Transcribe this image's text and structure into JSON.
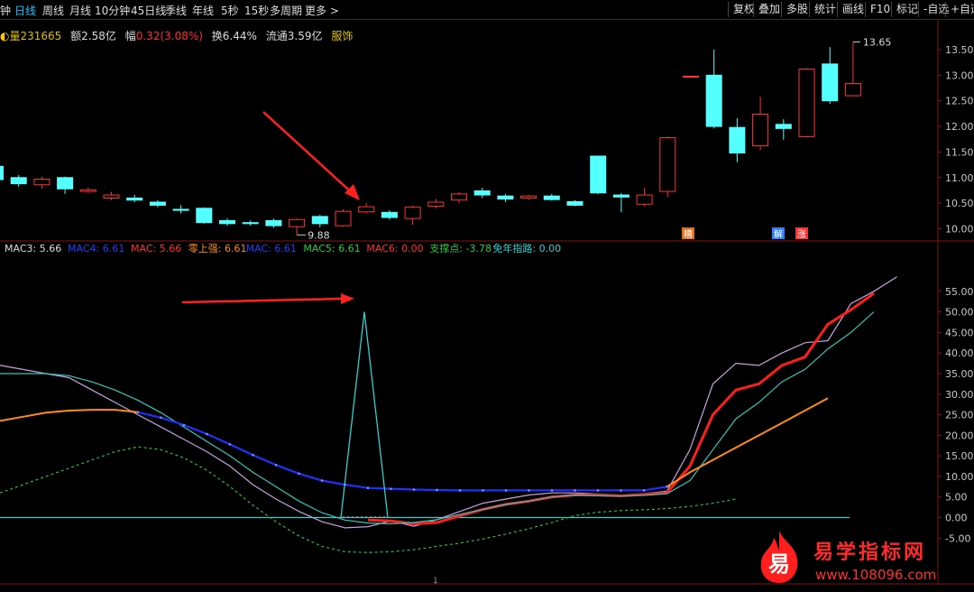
{
  "timeframes": [
    {
      "label": "钟",
      "x": 0
    },
    {
      "label": "日线",
      "x": 16,
      "active": true
    },
    {
      "label": "周线",
      "x": 47
    },
    {
      "label": "月线",
      "x": 77
    },
    {
      "label": "10分钟",
      "x": 105
    },
    {
      "label": "45日线",
      "x": 145
    },
    {
      "label": "季线",
      "x": 183
    },
    {
      "label": "年线",
      "x": 213
    },
    {
      "label": "5秒",
      "x": 245
    },
    {
      "label": "15秒",
      "x": 271
    },
    {
      "label": "多周期",
      "x": 299
    },
    {
      "label": "更多 >",
      "x": 338
    }
  ],
  "tools": [
    {
      "label": "复权",
      "x": 807
    },
    {
      "label": "叠加",
      "x": 835
    },
    {
      "label": "多股",
      "x": 866
    },
    {
      "label": "统计",
      "x": 897
    },
    {
      "label": "画线",
      "x": 928
    },
    {
      "label": "F10",
      "x": 959
    },
    {
      "label": "标记",
      "x": 988
    },
    {
      "label": "-自选",
      "x": 1018
    },
    {
      "label": "+自选",
      "x": 1048
    }
  ],
  "info": {
    "vol_label": "量",
    "vol": "231665",
    "amt_label": "额",
    "amt": "2.58亿",
    "chg_label": "幅",
    "chg": "0.32(3.08%)",
    "turn_label": "换",
    "turn": "6.44%",
    "float_label": "流通",
    "float": "3.59亿",
    "industry": "服饰"
  },
  "indicator_legend": [
    {
      "text": "MAC3: 5.66",
      "color": "#dddddd"
    },
    {
      "text": "MAC4: 6.61",
      "color": "#2040ff"
    },
    {
      "text": "MAC: 5.66",
      "color": "#ff3030"
    },
    {
      "text": "零上强: 6.61",
      "color": "#ff8c1a"
    },
    {
      "text": "MAC: 6.61",
      "color": "#2040ff"
    },
    {
      "text": "MAC5: 6.61",
      "color": "#20d040"
    },
    {
      "text": "MAC6: 0.00",
      "color": "#ff3030"
    },
    {
      "text": "支撑点: -3.78",
      "color": "#20d040"
    },
    {
      "text": "免年指路: 0.00",
      "color": "#30d0d0"
    }
  ],
  "price_axis": {
    "ticks": [
      "13.50",
      "13.00",
      "12.50",
      "12.00",
      "11.50",
      "11.00",
      "10.50",
      "10.00"
    ]
  },
  "indicator_axis": {
    "ticks": [
      "55.00",
      "50.00",
      "45.00",
      "40.00",
      "35.00",
      "30.00",
      "25.00",
      "20.00",
      "15.00",
      "10.00",
      "5.00",
      "0.00",
      "-5.00"
    ]
  },
  "annotations": {
    "high_label": "13.65",
    "low_label": "9.88",
    "marker_a": "糟",
    "marker_b": "解",
    "marker_c": "涨",
    "x_tick": "1"
  },
  "watermark": {
    "title": "易学指标网",
    "url": "www.108096.com",
    "logo_char": "易"
  },
  "colors": {
    "up": "#ff3232",
    "down": "#54ffff",
    "bg": "#000000",
    "axis": "#8a1010"
  },
  "chart_data": [
    {
      "type": "candlestick",
      "ylim": [
        9.85,
        13.8
      ],
      "candles": [
        {
          "o": 11.22,
          "c": 10.96,
          "h": 11.3,
          "l": 10.9
        },
        {
          "o": 11.0,
          "c": 10.88,
          "h": 11.05,
          "l": 10.82
        },
        {
          "o": 10.86,
          "c": 10.97,
          "h": 11.02,
          "l": 10.78
        },
        {
          "o": 11.0,
          "c": 10.78,
          "h": 11.02,
          "l": 10.68
        },
        {
          "o": 10.73,
          "c": 10.76,
          "h": 10.8,
          "l": 10.7
        },
        {
          "o": 10.6,
          "c": 10.66,
          "h": 10.72,
          "l": 10.56
        },
        {
          "o": 10.6,
          "c": 10.56,
          "h": 10.66,
          "l": 10.52
        },
        {
          "o": 10.52,
          "c": 10.46,
          "h": 10.56,
          "l": 10.42
        },
        {
          "o": 10.38,
          "c": 10.36,
          "h": 10.46,
          "l": 10.3
        },
        {
          "o": 10.4,
          "c": 10.12,
          "h": 10.42,
          "l": 10.1
        },
        {
          "o": 10.16,
          "c": 10.1,
          "h": 10.2,
          "l": 10.06
        },
        {
          "o": 10.12,
          "c": 10.1,
          "h": 10.16,
          "l": 10.06
        },
        {
          "o": 10.16,
          "c": 10.06,
          "h": 10.2,
          "l": 10.02
        },
        {
          "o": 10.04,
          "c": 10.18,
          "h": 10.2,
          "l": 9.88
        },
        {
          "o": 10.24,
          "c": 10.1,
          "h": 10.27,
          "l": 10.03
        },
        {
          "o": 10.06,
          "c": 10.34,
          "h": 10.38,
          "l": 10.04
        },
        {
          "o": 10.33,
          "c": 10.43,
          "h": 10.5,
          "l": 10.3
        },
        {
          "o": 10.32,
          "c": 10.22,
          "h": 10.36,
          "l": 10.18
        },
        {
          "o": 10.2,
          "c": 10.42,
          "h": 10.45,
          "l": 10.08
        },
        {
          "o": 10.44,
          "c": 10.52,
          "h": 10.58,
          "l": 10.4
        },
        {
          "o": 10.56,
          "c": 10.68,
          "h": 10.72,
          "l": 10.5
        },
        {
          "o": 10.74,
          "c": 10.66,
          "h": 10.8,
          "l": 10.6
        },
        {
          "o": 10.64,
          "c": 10.58,
          "h": 10.68,
          "l": 10.52
        },
        {
          "o": 10.6,
          "c": 10.64,
          "h": 10.66,
          "l": 10.56
        },
        {
          "o": 10.64,
          "c": 10.57,
          "h": 10.68,
          "l": 10.55
        },
        {
          "o": 10.53,
          "c": 10.46,
          "h": 10.56,
          "l": 10.44
        },
        {
          "o": 11.42,
          "c": 10.7,
          "h": 11.42,
          "l": 10.68
        },
        {
          "o": 10.66,
          "c": 10.62,
          "h": 10.7,
          "l": 10.32
        },
        {
          "o": 10.48,
          "c": 10.66,
          "h": 10.8,
          "l": 10.44
        },
        {
          "o": 10.73,
          "c": 11.78,
          "h": 11.8,
          "l": 10.62
        },
        {
          "o": 12.98,
          "c": 12.98,
          "h": 12.98,
          "l": 12.98
        },
        {
          "o": 13.0,
          "c": 12.0,
          "h": 13.5,
          "l": 11.96
        },
        {
          "o": 11.98,
          "c": 11.48,
          "h": 12.16,
          "l": 11.3
        },
        {
          "o": 11.62,
          "c": 12.24,
          "h": 12.58,
          "l": 11.54
        },
        {
          "o": 12.04,
          "c": 11.96,
          "h": 12.14,
          "l": 11.74
        },
        {
          "o": 11.8,
          "c": 13.12,
          "h": 13.14,
          "l": 11.78
        },
        {
          "o": 13.22,
          "c": 12.5,
          "h": 13.55,
          "l": 12.44
        },
        {
          "o": 12.6,
          "c": 12.84,
          "h": 13.65,
          "l": 12.6
        }
      ]
    },
    {
      "type": "line",
      "ylim": [
        -8,
        60
      ],
      "series": [
        {
          "name": "MAC3",
          "color": "#c8a0e0",
          "values": [
            37,
            36,
            35,
            34,
            31,
            28,
            25,
            22,
            19,
            16,
            12.5,
            8,
            4.5,
            1.5,
            -1,
            -2.5,
            -2.2,
            -0.8,
            -2.1,
            -0.5,
            1.5,
            3.5,
            4.5,
            5.5,
            6,
            6,
            5.7,
            5.4,
            5.8,
            6.4,
            16.5,
            32.5,
            37.5,
            37,
            40,
            42.5,
            43,
            52,
            55,
            58.5
          ]
        },
        {
          "name": "MAC",
          "color": "#ff1e1e",
          "values": [
            null,
            null,
            null,
            null,
            null,
            null,
            null,
            null,
            null,
            null,
            null,
            null,
            null,
            null,
            null,
            null,
            -0.6,
            -0.8,
            -1.5,
            -1.2,
            0.4,
            2,
            3.2,
            4,
            5,
            5.5,
            5.5,
            5.3,
            5.6,
            6,
            12.5,
            25,
            31,
            32.5,
            37,
            39,
            47,
            50.5,
            54.5
          ]
        },
        {
          "name": "MAC5",
          "color": "#30c8b8",
          "values": [
            35,
            35,
            35,
            34.5,
            33,
            31,
            28.5,
            25.5,
            22,
            18.5,
            15,
            11,
            7.5,
            4,
            1.2,
            -0.6,
            -1.3,
            -1.5,
            -1.2,
            -0.5,
            0.8,
            2,
            3.2,
            4,
            5,
            5.5,
            5.3,
            5.2,
            5.4,
            5.8,
            9,
            16.5,
            24,
            28,
            33,
            36,
            41,
            45,
            50
          ]
        },
        {
          "name": "零上强",
          "color": "#ff8c1a",
          "values": [
            23.5,
            24.5,
            25.5,
            26,
            26.2,
            26.2,
            25.6,
            null,
            null,
            null,
            null,
            null,
            null,
            null,
            null,
            null,
            null,
            null,
            null,
            null,
            null,
            null,
            null,
            null,
            null,
            null,
            null,
            null,
            null,
            null,
            7.5,
            11,
            14,
            17,
            20,
            23,
            26,
            29
          ]
        },
        {
          "name": "MAC4",
          "color": "#2030ff",
          "values": [
            null,
            null,
            null,
            null,
            null,
            null,
            25.6,
            24.3,
            22.5,
            20.3,
            17.8,
            15.2,
            12.8,
            10.7,
            9,
            8,
            7.2,
            7,
            6.8,
            6.7,
            6.6,
            6.6,
            6.6,
            6.6,
            6.6,
            6.6,
            6.6,
            6.6,
            6.6,
            7.5
          ]
        },
        {
          "name": "支撑点",
          "color": "#20c040",
          "values": [
            6,
            8,
            10,
            12,
            14,
            16,
            17.2,
            16.5,
            14.5,
            11.5,
            7.5,
            3,
            -1,
            -4.5,
            -7,
            -8.3,
            -8.5,
            -8.3,
            -7.8,
            -7,
            -6.2,
            -5.2,
            -4,
            -2.7,
            -1.2,
            0.5,
            1.3,
            1.7,
            1.9,
            2.2,
            2.7,
            3.5,
            4.5
          ]
        },
        {
          "name": "免年指路",
          "color": "#30d0d0",
          "values": [
            0,
            0,
            0,
            0,
            0,
            0,
            0,
            0,
            0,
            0,
            0,
            0,
            0,
            0,
            0,
            0,
            0,
            0,
            0,
            0,
            0,
            0,
            0,
            0,
            0,
            0,
            0,
            0,
            0,
            0,
            0,
            0,
            0,
            0,
            0,
            0,
            0
          ]
        }
      ],
      "spike": {
        "value": 50
      }
    }
  ]
}
